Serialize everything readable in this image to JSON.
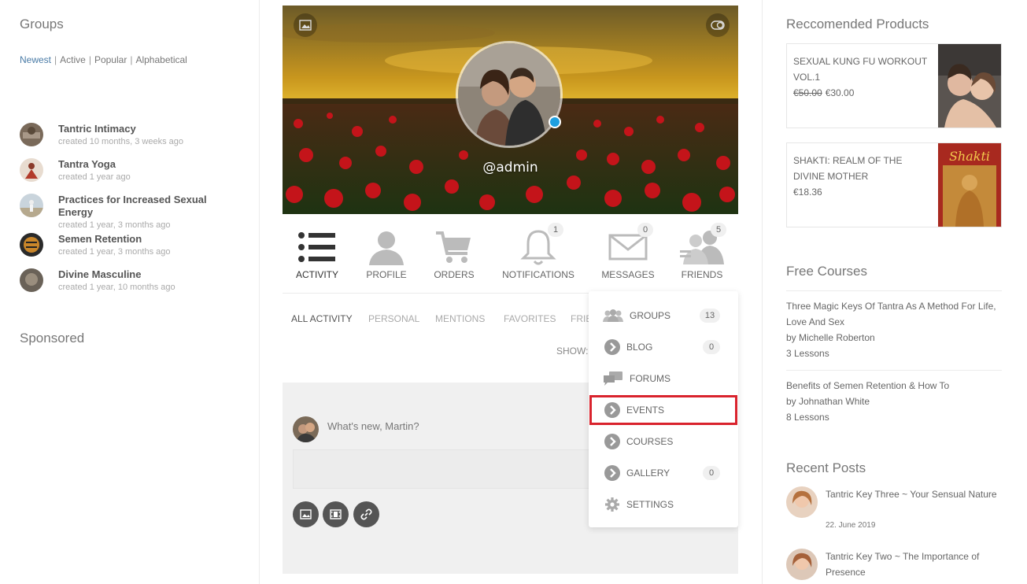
{
  "groups_widget": {
    "title": "Groups",
    "filters": [
      "Newest",
      "Active",
      "Popular",
      "Alphabetical"
    ],
    "active_filter": "Newest",
    "items": [
      {
        "name": "Tantric Intimacy",
        "meta": "created 10 months, 3 weeks ago"
      },
      {
        "name": "Tantra Yoga",
        "meta": "created 1 year ago"
      },
      {
        "name": "Practices for Increased Sexual Energy",
        "meta": "created 1 year, 3 months ago"
      },
      {
        "name": "Semen Retention",
        "meta": "created 1 year, 3 months ago"
      },
      {
        "name": "Divine Masculine",
        "meta": "created 1 year, 10 months ago"
      }
    ]
  },
  "sponsored": {
    "title": "Sponsored"
  },
  "profile": {
    "username": "@admin"
  },
  "profile_nav": [
    {
      "label": "ACTIVITY",
      "icon": "list-icon",
      "badge": ""
    },
    {
      "label": "PROFILE",
      "icon": "user-icon",
      "badge": ""
    },
    {
      "label": "ORDERS",
      "icon": "cart-icon",
      "badge": ""
    },
    {
      "label": "NOTIFICATIONS",
      "icon": "bell-icon",
      "badge": "1"
    },
    {
      "label": "MESSAGES",
      "icon": "envelope-icon",
      "badge": "0"
    },
    {
      "label": "FRIENDS",
      "icon": "friends-icon",
      "badge": "5"
    }
  ],
  "activity_tabs": [
    "ALL ACTIVITY",
    "PERSONAL",
    "MENTIONS",
    "FAVORITES",
    "FRIE"
  ],
  "show_label": "SHOW:",
  "post_form": {
    "prompt": "What's new, Martin?"
  },
  "dropdown": [
    {
      "label": "GROUPS",
      "icon": "groups-icon",
      "count": "13"
    },
    {
      "label": "BLOG",
      "icon": "chevron-right-circle-icon",
      "count": "0"
    },
    {
      "label": "FORUMS",
      "icon": "forums-icon",
      "count": ""
    },
    {
      "label": "EVENTS",
      "icon": "chevron-right-circle-icon",
      "count": ""
    },
    {
      "label": "COURSES",
      "icon": "chevron-right-circle-icon",
      "count": ""
    },
    {
      "label": "GALLERY",
      "icon": "chevron-right-circle-icon",
      "count": "0"
    },
    {
      "label": "SETTINGS",
      "icon": "gear-icon",
      "count": ""
    }
  ],
  "highlight_color": "#d9232d",
  "recommended": {
    "title": "Reccomended Products",
    "products": [
      {
        "name": "SEXUAL KUNG FU WORKOUT VOL.1",
        "old_price": "€50.00",
        "price": "€30.00"
      },
      {
        "name": "SHAKTI: REALM OF THE DIVINE MOTHER",
        "old_price": "",
        "price": "€18.36"
      }
    ]
  },
  "free_courses": {
    "title": "Free Courses",
    "courses": [
      {
        "title": "Three Magic Keys Of Tantra As A Method For Life, Love And Sex",
        "author": "by Michelle Roberton",
        "lessons": "3 Lessons"
      },
      {
        "title": "Benefits of Semen Retention & How To",
        "author": "by Johnathan White",
        "lessons": "8 Lessons"
      }
    ]
  },
  "recent_posts": {
    "title": "Recent Posts",
    "posts": [
      {
        "title": "Tantric Key Three ~ Your Sensual Nature",
        "date": "22. June 2019"
      },
      {
        "title": "Tantric Key Two ~ The Importance of Presence",
        "date": ""
      }
    ]
  }
}
